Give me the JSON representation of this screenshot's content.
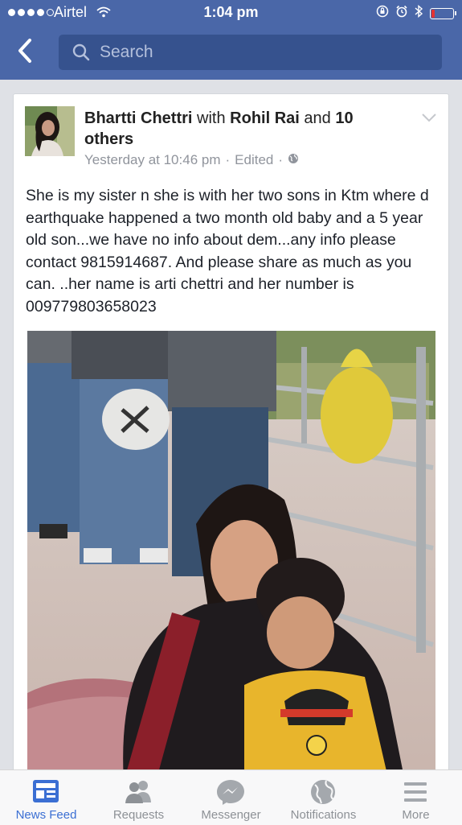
{
  "status_bar": {
    "carrier": "Airtel",
    "time": "1:04 pm",
    "battery_level": 0.15,
    "battery_color": "#e33333",
    "icons": [
      "signal-dots",
      "wifi-icon",
      "lock-rotation-icon",
      "alarm-icon",
      "bluetooth-icon",
      "battery-icon"
    ]
  },
  "nav": {
    "back_icon": "chevron-left-icon",
    "search_placeholder": "Search"
  },
  "post": {
    "author": "Bhartti Chettri",
    "with_word": "with",
    "tagged": "Rohil Rai",
    "and_word": "and",
    "others": "10 others",
    "timestamp": "Yesterday at 10:46 pm",
    "edited": "Edited",
    "privacy_icon": "globe-icon",
    "text": "She is my sister n she is with her two sons in Ktm where d earthquake happened a two month old baby and a 5 year old son...we have no info about dem...any info please contact 9815914687. And please share as much as you can. ..her name is arti chettri and her number is 009779803658023"
  },
  "tabs": [
    {
      "label": "News Feed",
      "icon": "news-feed-icon",
      "active": true
    },
    {
      "label": "Requests",
      "icon": "friends-icon",
      "active": false
    },
    {
      "label": "Messenger",
      "icon": "messenger-icon",
      "active": false
    },
    {
      "label": "Notifications",
      "icon": "globe-icon",
      "active": false
    },
    {
      "label": "More",
      "icon": "menu-icon",
      "active": false
    }
  ],
  "colors": {
    "brand": "#4a67a8",
    "search_box": "#36528e",
    "active_tab": "#3b6fd3",
    "inactive_tab": "#8d9196"
  }
}
